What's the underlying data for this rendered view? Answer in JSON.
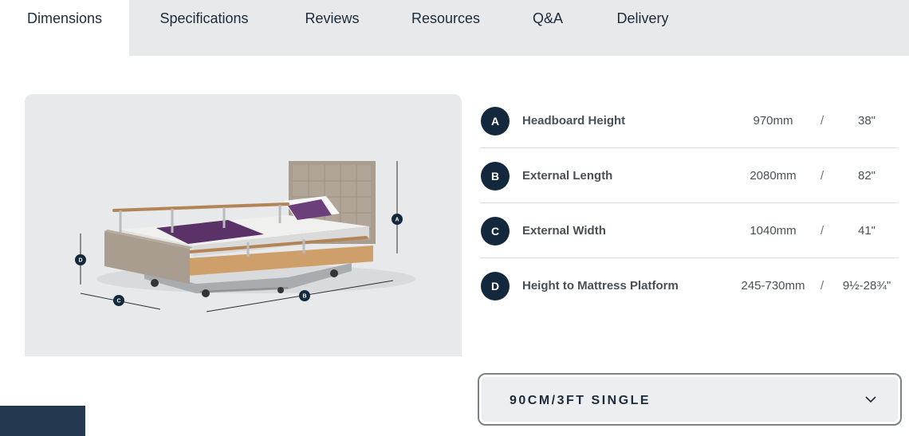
{
  "tabs": [
    {
      "label": "Dimensions",
      "active": true
    },
    {
      "label": "Specifications"
    },
    {
      "label": "Reviews"
    },
    {
      "label": "Resources"
    },
    {
      "label": "Q&A"
    },
    {
      "label": "Delivery"
    }
  ],
  "illustration": {
    "markers": [
      "A",
      "B",
      "C",
      "D"
    ]
  },
  "dimensions": [
    {
      "letter": "A",
      "label": "Headboard Height",
      "mm": "970mm",
      "separator": "/",
      "inches": "38\""
    },
    {
      "letter": "B",
      "label": "External Length",
      "mm": "2080mm",
      "separator": "/",
      "inches": "82\""
    },
    {
      "letter": "C",
      "label": "External Width",
      "mm": "1040mm",
      "separator": "/",
      "inches": "41\""
    },
    {
      "letter": "D",
      "label": "Height to Mattress Platform",
      "mm": "245-730mm",
      "separator": "/",
      "inches": "9½-28¾\""
    }
  ],
  "size_select": {
    "value": "90CM/3FT SINGLE",
    "icon": "chevron-down-icon"
  },
  "colors": {
    "badge": "#13283c",
    "tabbar": "#e8e9ea",
    "corner_block": "#24394f"
  }
}
